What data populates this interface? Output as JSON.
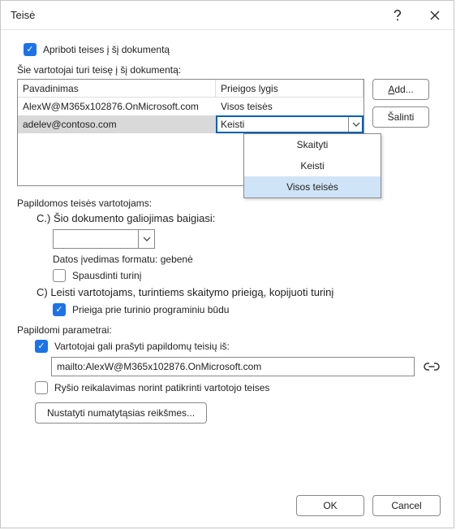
{
  "dialog": {
    "title": "Teisė"
  },
  "restrict": {
    "label": "Apriboti teises į šį dokumentą"
  },
  "users": {
    "heading": "Šie vartotojai turi teisę į šį dokumentą:",
    "col_name": "Pavadinimas",
    "col_level": "Prieigos lygis",
    "rows": [
      {
        "name": "AlexW@M365x102876.OnMicrosoft.com",
        "level": "Visos teisės"
      },
      {
        "name": "adelev@contoso.com",
        "level": "Keisti"
      }
    ]
  },
  "buttons": {
    "add": "A",
    "add_rest": "dd...",
    "remove": "Šalinti",
    "ok": "OK",
    "cancel": "Cancel",
    "defaults": "Nustatyti numatytąsias reikšmes..."
  },
  "dropdown": {
    "opt_read": "Skaityti",
    "opt_change": "Keisti",
    "opt_full": "Visos teisės"
  },
  "additional": {
    "heading": "Papildomos teisės vartotojams:",
    "expiry_label": "C.) Šio dokumento galiojimas baigiasi:",
    "date_hint": "Datos įvedimas formatu: gebenė",
    "print_label": "Spausdinti turinį",
    "copy_label": "C) Leisti vartotojams, turintiems skaitymo prieigą, kopijuoti turinį",
    "programmatic_label": "Prieiga prie turinio programiniu būdu"
  },
  "params": {
    "heading": "Papildomi parametrai:",
    "request_label": "Vartotojai gali prašyti papildomų teisių iš:",
    "request_value": "mailto:AlexW@M365x102876.OnMicrosoft.com",
    "connection_label": "Ryšio reikalavimas norint patikrinti vartotojo teises"
  }
}
